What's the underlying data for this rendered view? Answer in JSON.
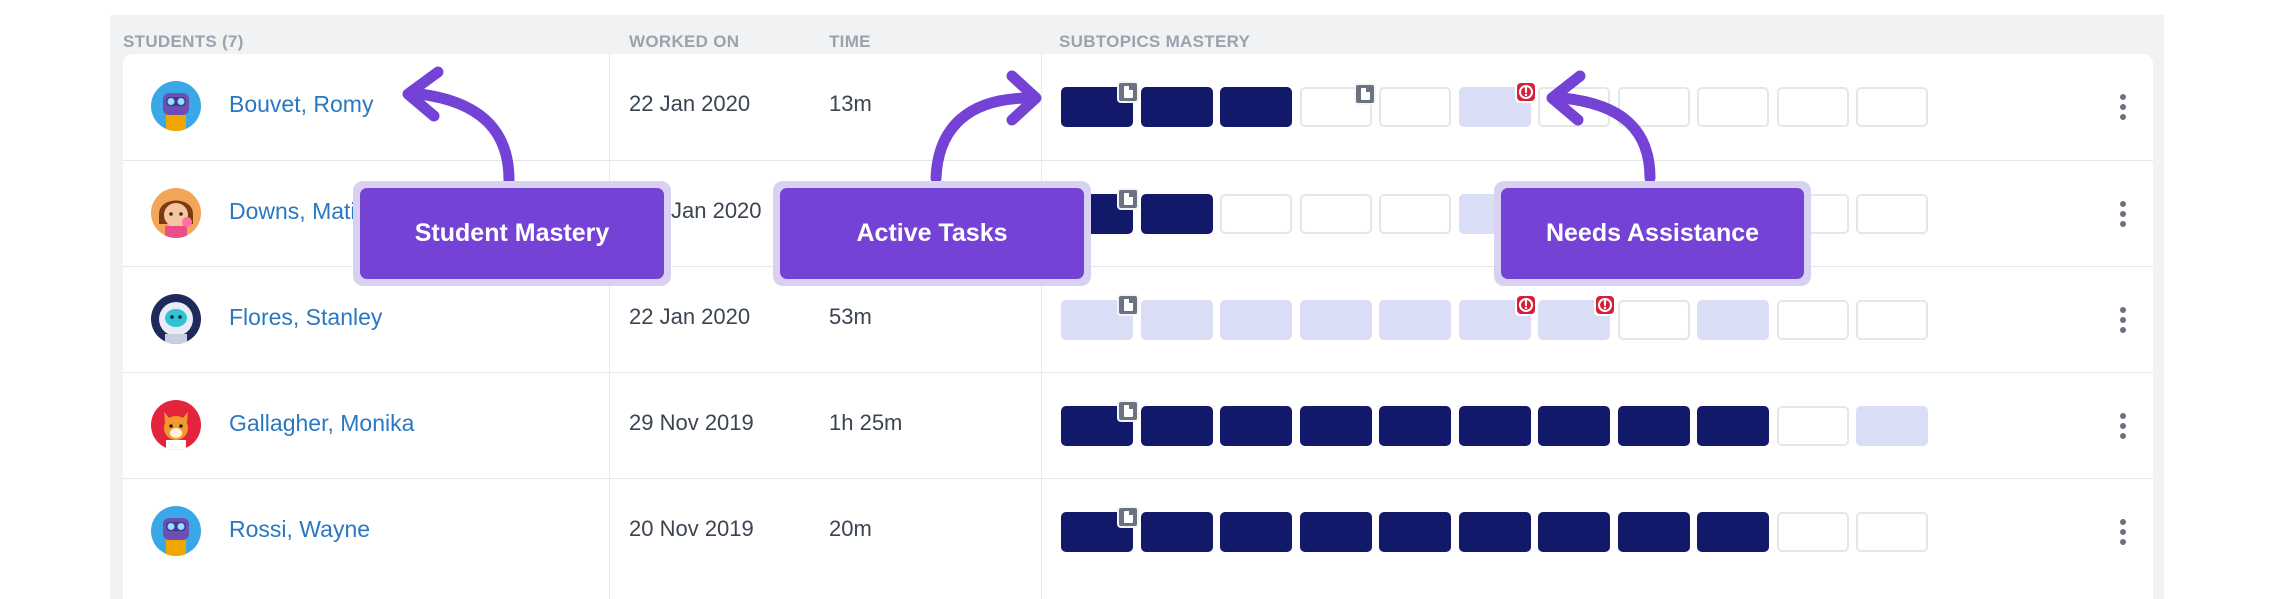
{
  "columns": {
    "students": "STUDENTS (7)",
    "worked_on": "WORKED ON",
    "time": "TIME",
    "subtopics": "SUBTOPICS MASTERY"
  },
  "students": [
    {
      "name": "Bouvet, Romy",
      "worked_on": "22 Jan 2020",
      "time": "13m",
      "avatar": "robot-blue-avatar",
      "cells": [
        {
          "state": "dark",
          "badge": "doc"
        },
        {
          "state": "dark"
        },
        {
          "state": "dark"
        },
        {
          "state": "empty",
          "badge": "doc"
        },
        {
          "state": "empty"
        },
        {
          "state": "light",
          "badge": "alert"
        },
        {
          "state": "empty"
        },
        {
          "state": "empty"
        },
        {
          "state": "empty"
        },
        {
          "state": "empty"
        },
        {
          "state": "empty"
        }
      ]
    },
    {
      "name": "Downs, Matil",
      "worked_on": "Jan 2020",
      "time": "",
      "avatar": "girl-avatar",
      "cells": [
        {
          "state": "dark",
          "badge": "doc"
        },
        {
          "state": "dark"
        },
        {
          "state": "empty"
        },
        {
          "state": "empty"
        },
        {
          "state": "empty"
        },
        {
          "state": "light"
        },
        {
          "state": "empty"
        },
        {
          "state": "empty"
        },
        {
          "state": "empty"
        },
        {
          "state": "empty"
        },
        {
          "state": "empty"
        }
      ]
    },
    {
      "name": "Flores, Stanley",
      "worked_on": "22 Jan 2020",
      "time": "53m",
      "avatar": "astronaut-avatar",
      "cells": [
        {
          "state": "light",
          "badge": "doc"
        },
        {
          "state": "light"
        },
        {
          "state": "light"
        },
        {
          "state": "light"
        },
        {
          "state": "light"
        },
        {
          "state": "light",
          "badge": "alert"
        },
        {
          "state": "light",
          "badge": "alert"
        },
        {
          "state": "empty"
        },
        {
          "state": "light"
        },
        {
          "state": "empty"
        },
        {
          "state": "empty"
        }
      ]
    },
    {
      "name": "Gallagher, Monika",
      "worked_on": "29 Nov 2019",
      "time": "1h 25m",
      "avatar": "fox-avatar",
      "cells": [
        {
          "state": "dark",
          "badge": "doc"
        },
        {
          "state": "dark"
        },
        {
          "state": "dark"
        },
        {
          "state": "dark"
        },
        {
          "state": "dark"
        },
        {
          "state": "dark"
        },
        {
          "state": "dark"
        },
        {
          "state": "dark"
        },
        {
          "state": "dark"
        },
        {
          "state": "empty"
        },
        {
          "state": "light"
        }
      ]
    },
    {
      "name": "Rossi, Wayne",
      "worked_on": "20 Nov 2019",
      "time": "20m",
      "avatar": "robot-blue-avatar",
      "cells": [
        {
          "state": "dark",
          "badge": "doc"
        },
        {
          "state": "dark"
        },
        {
          "state": "dark"
        },
        {
          "state": "dark"
        },
        {
          "state": "dark"
        },
        {
          "state": "dark"
        },
        {
          "state": "dark"
        },
        {
          "state": "dark"
        },
        {
          "state": "dark"
        },
        {
          "state": "empty"
        },
        {
          "state": "empty"
        }
      ]
    }
  ],
  "callouts": {
    "student_mastery": "Student Mastery",
    "active_tasks": "Active Tasks",
    "needs_assistance": "Needs Assistance"
  },
  "colors": {
    "mastered": "#13196a",
    "in_progress": "#d9ddf5",
    "callout": "#7443d6",
    "link": "#2a78c2",
    "alert": "#d62038"
  }
}
